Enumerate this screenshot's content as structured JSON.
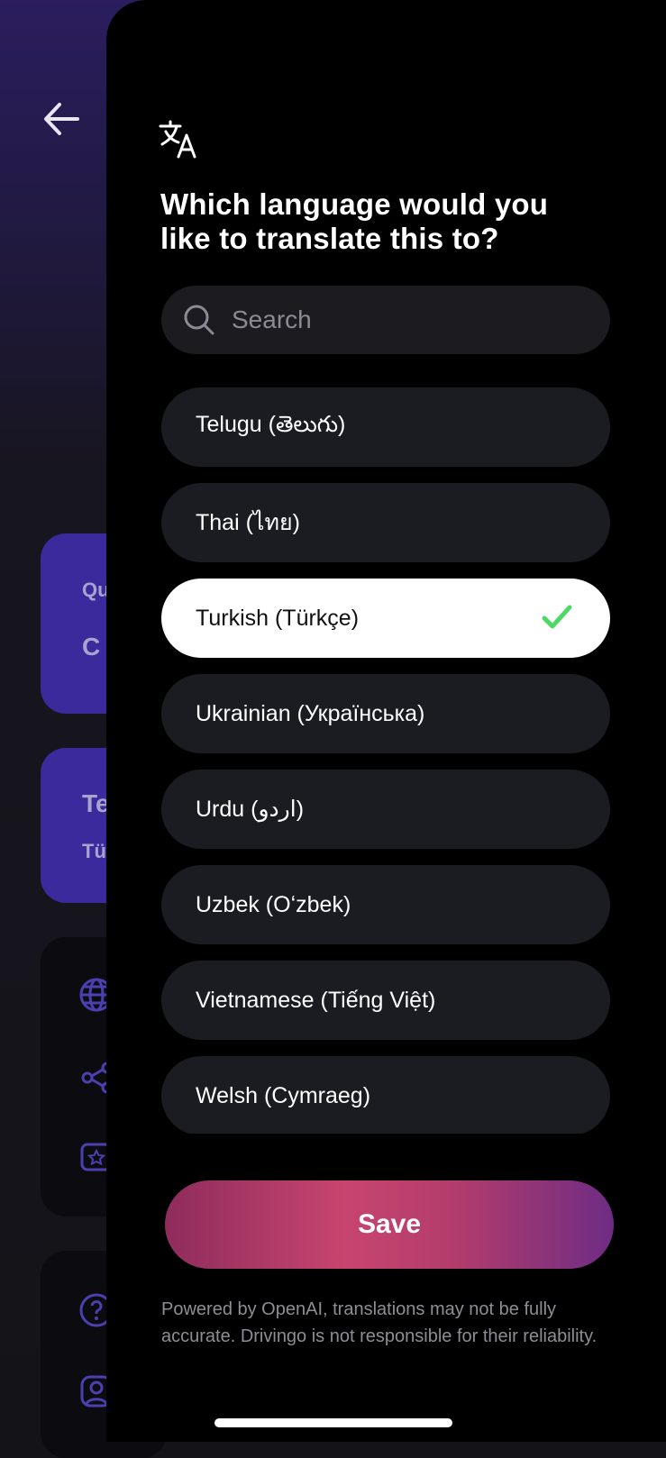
{
  "background": {
    "cards": [
      {
        "line1": "Qu",
        "line2": "C"
      },
      {
        "line1": "Te",
        "line2": "Tü"
      }
    ]
  },
  "drawer": {
    "title": "Which language would you like to translate this to?",
    "search": {
      "placeholder": "Search",
      "value": ""
    },
    "languages": [
      {
        "label": "Telugu (తెలుగు)",
        "selected": false
      },
      {
        "label": "Thai (ไทย)",
        "selected": false
      },
      {
        "label": "Turkish (Türkçe)",
        "selected": true
      },
      {
        "label": "Ukrainian (Українська)",
        "selected": false
      },
      {
        "label": "Urdu (اردو)",
        "selected": false
      },
      {
        "label": "Uzbek (Oʻzbek)",
        "selected": false
      },
      {
        "label": "Vietnamese (Tiếng Việt)",
        "selected": false
      },
      {
        "label": "Welsh (Cymraeg)",
        "selected": false
      }
    ],
    "save_label": "Save",
    "disclaimer": "Powered by OpenAI, translations may not be fully accurate. Drivingo is not responsible for their reliability."
  },
  "colors": {
    "accent_check": "#4cd964",
    "save_gradient_start": "#8e2c5c",
    "save_gradient_end": "#6e2c84",
    "background_purple": "#3a2a9c"
  },
  "icons": [
    "back-arrow-icon",
    "translate-icon",
    "search-icon",
    "checkmark-icon",
    "globe-icon",
    "share-icon",
    "star-card-icon",
    "help-icon",
    "profile-icon"
  ]
}
